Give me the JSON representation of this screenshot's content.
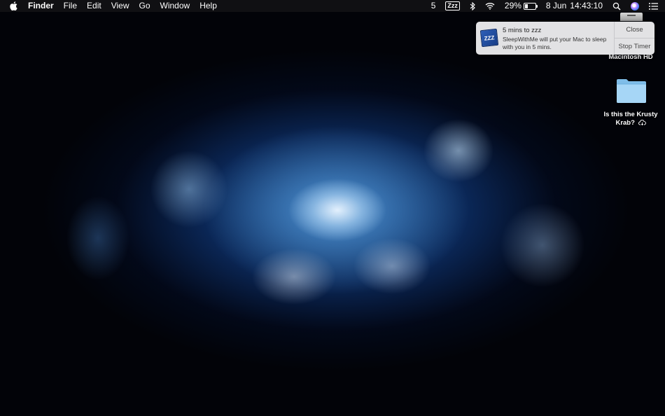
{
  "menubar": {
    "app_name": "Finder",
    "menus": [
      "File",
      "Edit",
      "View",
      "Go",
      "Window",
      "Help"
    ],
    "status": {
      "count": "5",
      "sleep_icon_text": "Zzz",
      "battery": "29%",
      "battery_level": 0.29,
      "date": "8 Jun",
      "time": "14:43:10"
    }
  },
  "notification": {
    "app_icon_text": "ZZZ",
    "title": "5 mins to zzz",
    "body": "SleepWithMe will put your Mac to sleep with you in 5 mins.",
    "actions": [
      "Close",
      "Stop Timer"
    ]
  },
  "desktop_icons": [
    {
      "label": "Macintosh HD",
      "icon": "hard-drive-icon"
    },
    {
      "label": "Is this the Krusty Krab?",
      "icon": "folder-icon",
      "badge": "icloud-download-icon"
    }
  ],
  "colors": {
    "menubar_bg": "#141416",
    "notification_bg": "#eeeef0",
    "folder": "#8fc8f0"
  }
}
